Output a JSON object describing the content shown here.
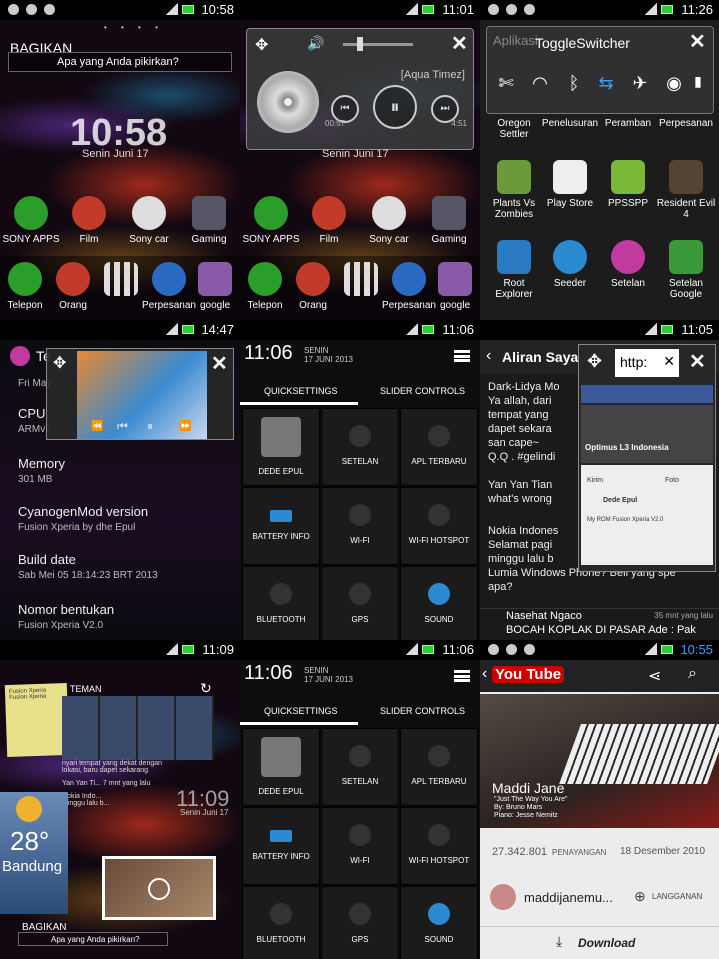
{
  "status": {
    "p1": "10:58",
    "p2": "11:01",
    "p3": "11:26",
    "p4": "14:47",
    "p5": "11:06",
    "p6": "11:05",
    "p7": "11:09",
    "p8": "11:06",
    "p9": "10:55"
  },
  "home": {
    "share_label": "BAGIKAN",
    "share_placeholder": "Apa yang Anda pikirkan?",
    "clock": "10:58",
    "date": "Senin Juni 17",
    "apps_row1": [
      "SONY APPS",
      "Film",
      "Sony car",
      "Gaming"
    ],
    "apps_row2": [
      "Telepon",
      "Orang",
      "Perpesanan",
      "google"
    ],
    "colors": {
      "green": "#2a9d2a",
      "red": "#c23a2a",
      "blue": "#2a6ac2",
      "accent": "#3aa0ff"
    }
  },
  "music": {
    "artist": "[Aqua Timez]",
    "elapsed": "00:57",
    "total": "4:51",
    "volume_level": 0.2
  },
  "toggle": {
    "title": "ToggleSwitcher",
    "behind_label": "Aplikasi",
    "apps_row1": [
      "Oregon Settler",
      "Penelusuran",
      "Peramban",
      "Perpesanan"
    ],
    "apps_row2": [
      "Plants Vs Zombies",
      "Play Store",
      "PPSSPP",
      "Resident Evil 4"
    ],
    "apps_row3": [
      "Root Explorer",
      "Seeder",
      "Setelan",
      "Setelan Google"
    ]
  },
  "about": {
    "partial_title": "Te",
    "partial_date": "Fri May",
    "cpu_label": "CPU",
    "cpu_value": "ARMv7",
    "memory_label": "Memory",
    "memory_value": "301 MB",
    "mod_label": "CyanogenMod version",
    "mod_value": "Fusion Xperia by dhe Epul",
    "build_label": "Build date",
    "build_value": "Sab Mei 05 18:14:23 BRT 2013",
    "number_label": "Nomor bentukan",
    "number_value": "Fusion Xperia V2.0"
  },
  "quicksettings": {
    "time": "11:06",
    "day": "SENIN",
    "date": "17 JUNI 2013",
    "tab1": "QUICKSETTINGS",
    "tab2": "SLIDER CONTROLS",
    "tiles": [
      "DEDE EPUL",
      "SETELAN",
      "APL TERBARU",
      "BATTERY INFO",
      "WI-FI",
      "WI-FI HOTSPOT",
      "BLUETOOTH",
      "GPS",
      "SOUND"
    ]
  },
  "stream": {
    "title": "Aliran Saya",
    "browser_url": "http:",
    "posts": [
      "Dark-Lidya Mo",
      "Ya allah, dari",
      "tempat yang",
      "dapet sekara",
      "san cape~",
      "Q.Q . #gelindi",
      "Yan Yan Tian",
      "what's wrong",
      "Nokia Indones",
      "Selamat pagi",
      "minggu lalu b",
      "Lumia Windows Phone? Beli yang spe",
      "apa?"
    ],
    "last_post_author": "Nasehat Ngaco",
    "last_post_time": "35 mnt yang lalu",
    "last_post_text": "BOCAH KOPLAK DI PASAR  Ade : Pak",
    "fb_group": "Optimus L3 Indonesia",
    "fb_user": "Dede Epul",
    "fb_post": "My ROM Fusion Xperia V2.0",
    "fb_kirim": "Kirim",
    "fb_foto": "Foto"
  },
  "widgets": {
    "note_title": "Fusion Xperia",
    "note_text": "Fusion Xperia",
    "friends_label": "TEMAN",
    "clock": "11:09",
    "clock_date": "Senin Juni 17",
    "temperature": "28°",
    "city": "Bandung",
    "share_label": "BAGIKAN",
    "share_placeholder": "Apa yang Anda pikirkan?",
    "feed_snippet": "nyari tempat yang dekat dengan lokasi, baru dapet sekarang",
    "feed_author": "Yan Yan Ti...",
    "feed_time": "7 mnt yang lalu",
    "feed_author2": "Nokia Indo...",
    "feed_text2": "minggu lalu b..."
  },
  "youtube": {
    "logo": "You Tube",
    "video_title": "Maddi Jane",
    "video_sub1": "\"Just The Way You Are\"",
    "video_sub2": "By: Bruno Mars",
    "video_sub3": "Piano: Jesse Nemitz",
    "views": "27.342.801",
    "views_label": "PENAYANGAN",
    "upload_date": "18 Desember 2010",
    "channel": "maddijanemu...",
    "subscribe": "LANGGANAN",
    "download": "Download",
    "time": "10:55"
  }
}
